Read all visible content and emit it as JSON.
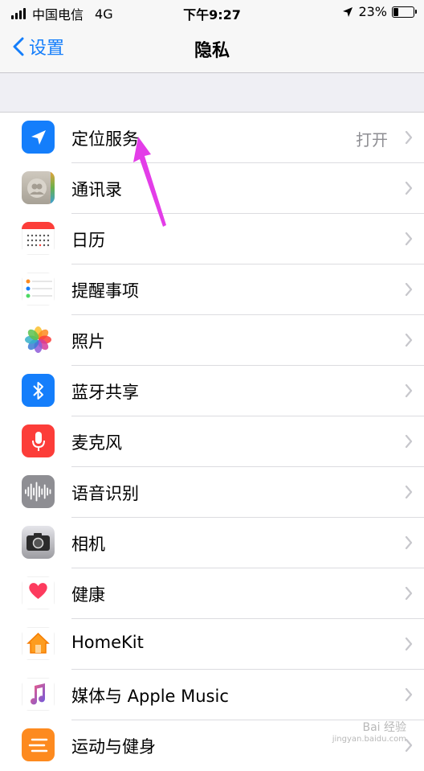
{
  "status_bar": {
    "carrier": "中国电信",
    "network": "4G",
    "time": "下午9:27",
    "battery": "23%",
    "battery_level": 0.23
  },
  "nav": {
    "back_label": "设置",
    "title": "隐私"
  },
  "rows": [
    {
      "label": "定位服务",
      "value": "打开",
      "icon": "location-arrow-icon",
      "color": "#147efb"
    },
    {
      "label": "通讯录",
      "value": "",
      "icon": "contacts-icon",
      "color": "#b9b3a8"
    },
    {
      "label": "日历",
      "value": "",
      "icon": "calendar-icon",
      "color": "#ffffff"
    },
    {
      "label": "提醒事项",
      "value": "",
      "icon": "reminders-icon",
      "color": "#ffffff"
    },
    {
      "label": "照片",
      "value": "",
      "icon": "photos-icon",
      "color": "#ffffff"
    },
    {
      "label": "蓝牙共享",
      "value": "",
      "icon": "bluetooth-icon",
      "color": "#147efb"
    },
    {
      "label": "麦克风",
      "value": "",
      "icon": "microphone-icon",
      "color": "#fc3d39"
    },
    {
      "label": "语音识别",
      "value": "",
      "icon": "speech-recognition-icon",
      "color": "#8e8e93"
    },
    {
      "label": "相机",
      "value": "",
      "icon": "camera-icon",
      "color": "#8e8e93"
    },
    {
      "label": "健康",
      "value": "",
      "icon": "health-heart-icon",
      "color": "#ffffff"
    },
    {
      "label": "HomeKit",
      "value": "",
      "icon": "homekit-house-icon",
      "color": "#ffffff"
    },
    {
      "label": "媒体与 Apple Music",
      "value": "",
      "icon": "music-note-icon",
      "color": "#ffffff"
    },
    {
      "label": "运动与健身",
      "value": "",
      "icon": "motion-fitness-icon",
      "color": "#fd8a1f"
    }
  ],
  "annotation": {
    "arrow_color": "#e33de8"
  },
  "watermark": {
    "text": "Bai 经验",
    "sub": "jingyan.baidu.com"
  }
}
